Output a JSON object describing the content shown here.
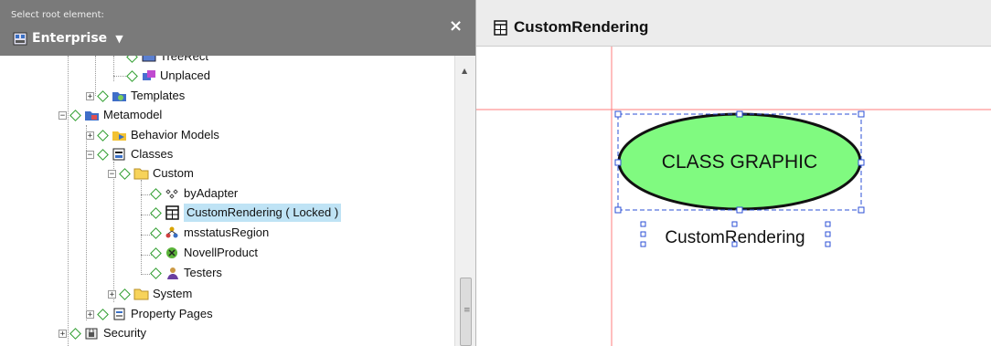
{
  "left_panel": {
    "select_label": "Select root element:",
    "root_value": "Enterprise",
    "close_label": "×"
  },
  "tree": [
    {
      "label": "TreeRect",
      "icon": "treerect-icon"
    },
    {
      "label": "Unplaced",
      "icon": "unplaced-icon"
    },
    {
      "label": "Templates",
      "icon": "templates-icon"
    },
    {
      "label": "Metamodel",
      "icon": "metamodel-icon"
    },
    {
      "label": "Behavior Models",
      "icon": "behavior-models-icon"
    },
    {
      "label": "Classes",
      "icon": "classes-icon"
    },
    {
      "label": "Custom",
      "icon": "folder-icon"
    },
    {
      "label": "byAdapter",
      "icon": "adapter-icon"
    },
    {
      "label": "CustomRendering ( Locked )",
      "icon": "class-table-icon"
    },
    {
      "label": "msstatusRegion",
      "icon": "region-icon"
    },
    {
      "label": "NovellProduct",
      "icon": "novell-icon"
    },
    {
      "label": "Testers",
      "icon": "testers-icon"
    },
    {
      "label": "System",
      "icon": "folder-icon"
    },
    {
      "label": "Property Pages",
      "icon": "property-pages-icon"
    },
    {
      "label": "Security",
      "icon": "security-icon"
    }
  ],
  "editor": {
    "title": "CustomRendering",
    "ellipse_text": "CLASS GRAPHIC",
    "caption": "CustomRendering"
  },
  "colors": {
    "ellipse_fill": "#80fa80",
    "guide_line": "#ff7c7c",
    "selection": "#2b4fd6",
    "tree_selected": "#bfe3f5"
  }
}
